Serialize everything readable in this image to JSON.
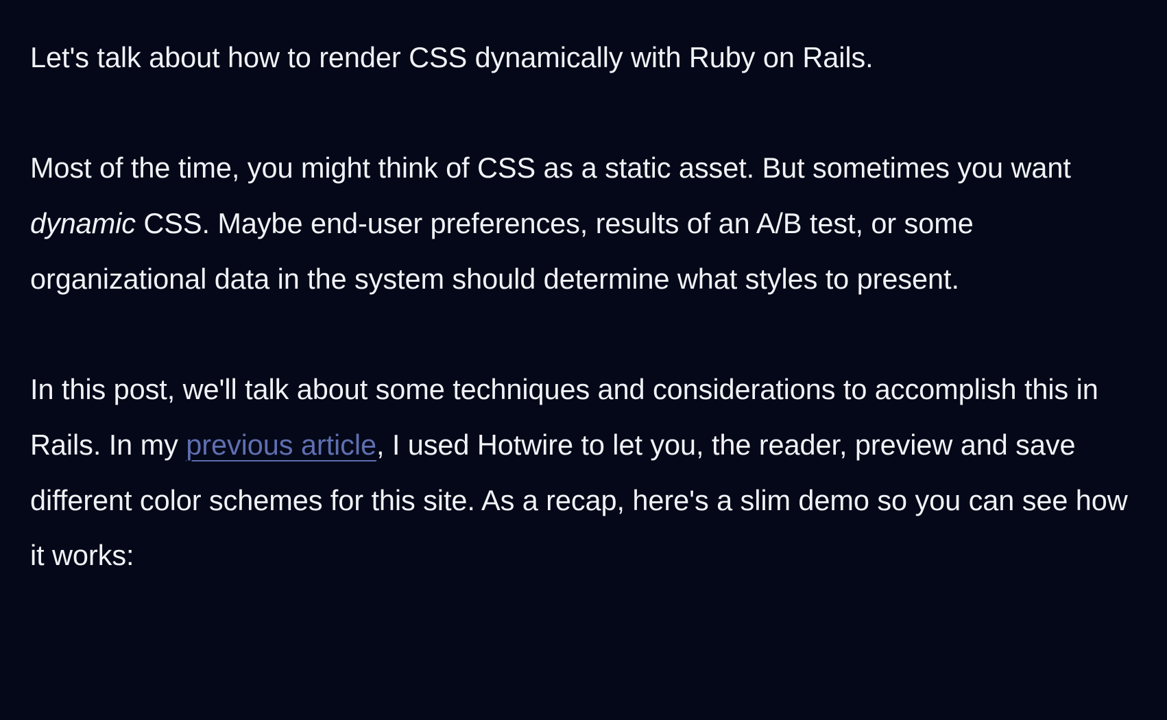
{
  "paragraphs": {
    "p1": {
      "text": "Let's talk about how to render CSS dynamically with Ruby on Rails."
    },
    "p2": {
      "before_em": "Most of the time, you might think of CSS as a static asset. But sometimes you want ",
      "em": "dynamic",
      "after_em": " CSS. Maybe end-user preferences, results of an A/B test, or some organizational data in the system should determine what styles to present."
    },
    "p3": {
      "before_link": "In this post, we'll talk about some techniques and considerations to accomplish this in Rails. In my ",
      "link": "previous article",
      "after_link": ", I used Hotwire to let you, the reader, preview and save different color schemes for this site. As a recap, here's a slim demo so you can see how it works:"
    }
  }
}
